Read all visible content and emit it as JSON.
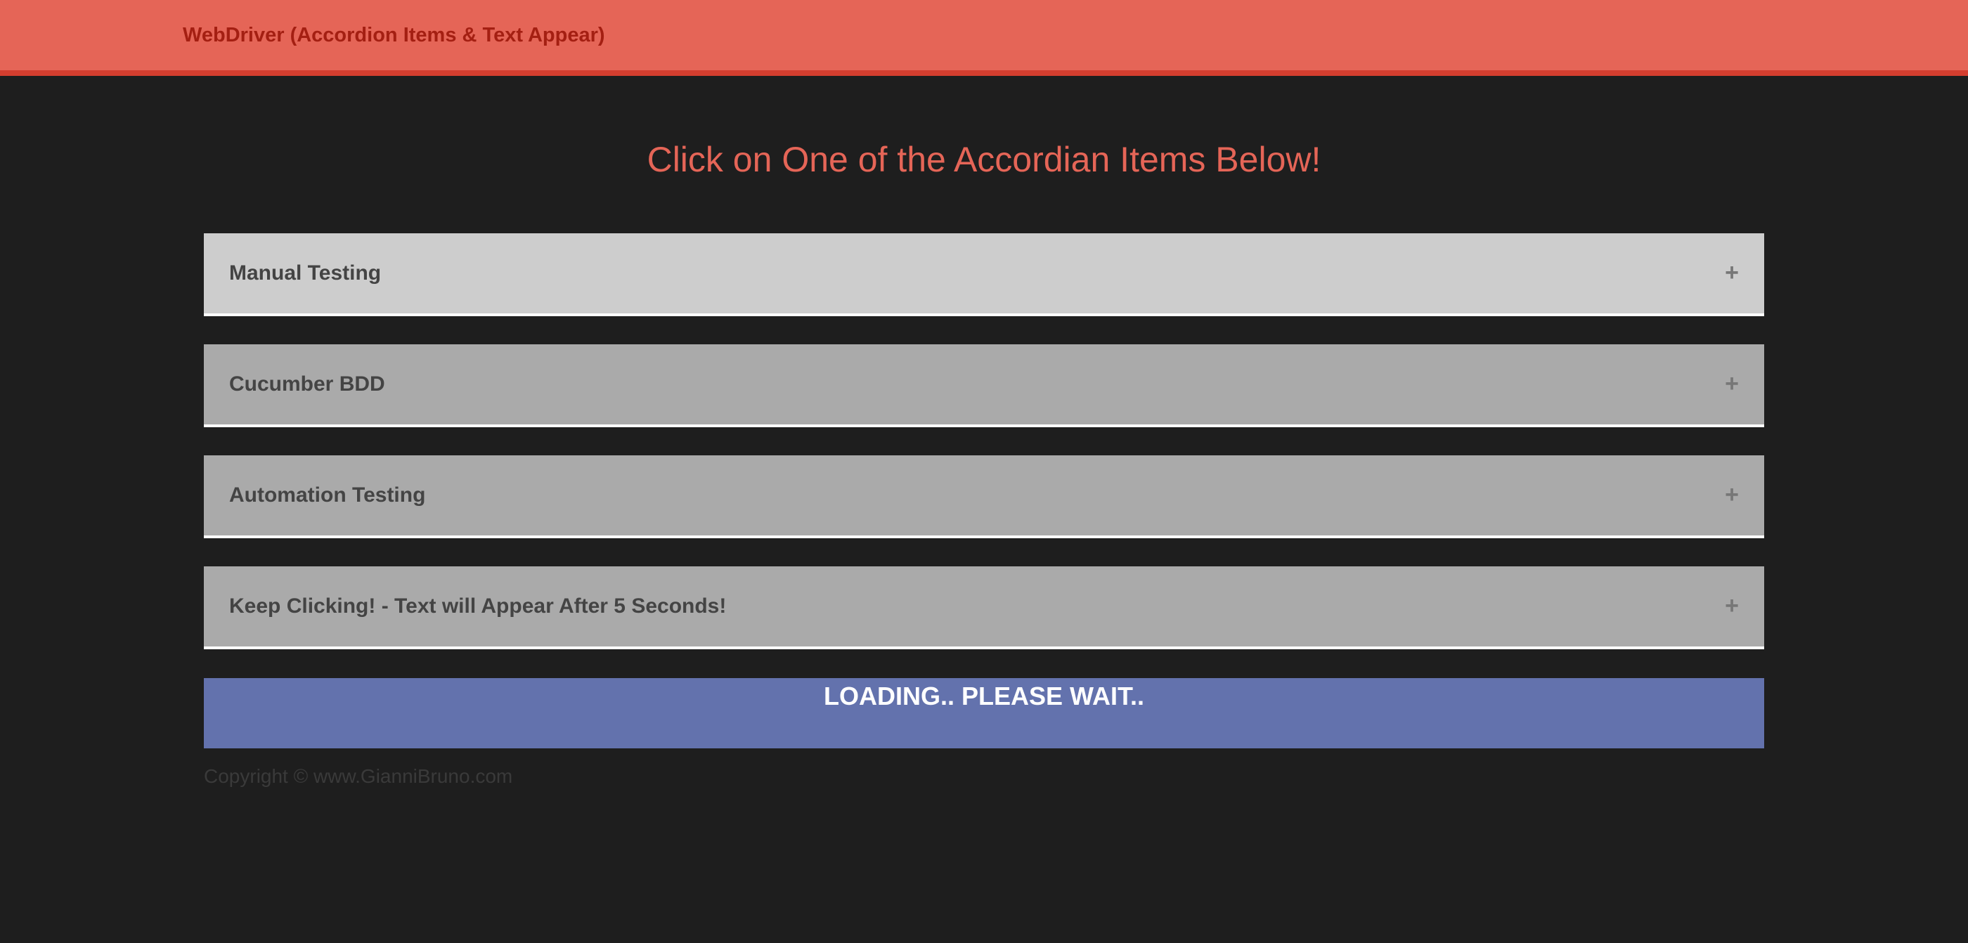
{
  "navbar": {
    "brand": "WebDriver (Accordion Items & Text Appear)",
    "color": "#e56557",
    "border_color": "#d43e2f"
  },
  "heading": "Click on One of the Accordian Items Below!",
  "accordion": {
    "items": [
      {
        "label": "Manual Testing",
        "icon": "+",
        "state": "highlighted",
        "background": "#cdcdcd"
      },
      {
        "label": "Cucumber BDD",
        "icon": "+",
        "state": "collapsed",
        "background": "#aaaaaa"
      },
      {
        "label": "Automation Testing",
        "icon": "+",
        "state": "collapsed",
        "background": "#aaaaaa"
      },
      {
        "label": "Keep Clicking! - Text will Appear After 5 Seconds!",
        "icon": "+",
        "state": "collapsed",
        "background": "#aaaaaa"
      }
    ]
  },
  "loading": {
    "text": "LOADING.. PLEASE WAIT..",
    "background": "#6372ad"
  },
  "footer": {
    "copyright": "Copyright © www.GianniBruno.com"
  }
}
